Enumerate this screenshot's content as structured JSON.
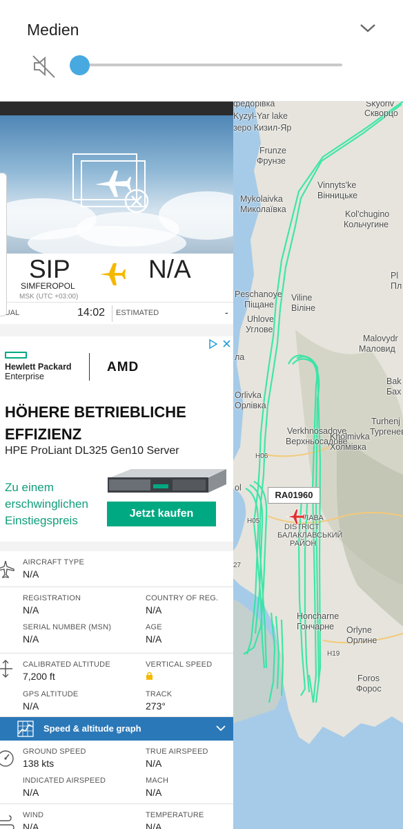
{
  "media": {
    "title": "Medien",
    "volume_level": 0.0,
    "mute_icon": "speaker-muted-icon",
    "collapse_icon": "chevron-down-icon"
  },
  "map": {
    "track_color": "#2de6a3",
    "labels": [
      {
        "text": "федорівка"
      },
      {
        "text": "Kyzyl-Yar lake"
      },
      {
        "text": "зеро Кизил-Яр"
      },
      {
        "text": "Skyoriv"
      },
      {
        "text": "Скворцо"
      },
      {
        "text": "Frunze"
      },
      {
        "text": "Фрунзе"
      },
      {
        "text": "Vinnyts'ke"
      },
      {
        "text": "Вінницьке"
      },
      {
        "text": "Mykolaivka"
      },
      {
        "text": "Миколаївка"
      },
      {
        "text": "Kol'chugino"
      },
      {
        "text": "Кольчугине"
      },
      {
        "text": "Pl"
      },
      {
        "text": "Пл"
      },
      {
        "text": "Peschanoye"
      },
      {
        "text": "Піщане"
      },
      {
        "text": "Viline"
      },
      {
        "text": "Віліне"
      },
      {
        "text": "Uhlove"
      },
      {
        "text": "Углове"
      },
      {
        "text": "Malovydr"
      },
      {
        "text": "Маловид"
      },
      {
        "text": "Bak"
      },
      {
        "text": "Бах"
      },
      {
        "text": "Orlivka"
      },
      {
        "text": "Орлівка"
      },
      {
        "text": "Turhenj"
      },
      {
        "text": "Тургенев"
      },
      {
        "text": "Verkhnosadove"
      },
      {
        "text": "Верхньосадове"
      },
      {
        "text": "Kholmivka"
      },
      {
        "text": "Холмівка"
      },
      {
        "text": "H06"
      },
      {
        "text": "H05"
      },
      {
        "text": "ЛАВА"
      },
      {
        "text": "DISTRICT"
      },
      {
        "text": "БАЛАКЛАВСЬКИЙ"
      },
      {
        "text": "РАЙОН"
      },
      {
        "text": "Honcharne"
      },
      {
        "text": "Гончарне"
      },
      {
        "text": "Orlyne"
      },
      {
        "text": "Орлине"
      },
      {
        "text": "H19"
      },
      {
        "text": "Foros"
      },
      {
        "text": "Форос"
      },
      {
        "text": "ol"
      },
      {
        "text": "ла"
      },
      {
        "text": "27"
      }
    ],
    "callsign": "RA01960"
  },
  "flight": {
    "photo_placeholder_icon": "no-photo-icon",
    "origin_code": "SIP",
    "origin_city": "SIMFEROPOL",
    "origin_tz": "MSK (UTC +03:00)",
    "destination_code": "N/A",
    "actual_label": "TUAL",
    "actual_time": "14:02",
    "estimated_label": "ESTIMATED",
    "estimated_time": "-"
  },
  "ad": {
    "brand_line1": "Hewlett Packard",
    "brand_line2": "Enterprise",
    "partner": "AMD",
    "headline": "HÖHERE BETRIEBLICHE EFFIZIENZ",
    "subline": "HPE ProLiant DL325 Gen10 Server",
    "promo": "Zu einem erschwinglichen Einstiegspreis",
    "cta": "Jetzt kaufen",
    "accent": "#01a982"
  },
  "details": {
    "aircraft_type_label": "AIRCRAFT TYPE",
    "aircraft_type": "N/A",
    "registration_label": "REGISTRATION",
    "registration": "N/A",
    "country_label": "COUNTRY OF REG.",
    "country": "N/A",
    "msn_label": "SERIAL NUMBER (MSN)",
    "msn": "N/A",
    "age_label": "AGE",
    "age": "N/A",
    "cal_alt_label": "CALIBRATED ALTITUDE",
    "cal_alt": "7,200 ft",
    "vspeed_label": "VERTICAL SPEED",
    "gps_alt_label": "GPS ALTITUDE",
    "gps_alt": "N/A",
    "track_label": "TRACK",
    "track": "273°",
    "graph_label": "Speed & altitude graph",
    "ground_speed_label": "GROUND SPEED",
    "ground_speed": "138 kts",
    "tas_label": "TRUE AIRSPEED",
    "tas": "N/A",
    "ias_label": "INDICATED AIRSPEED",
    "ias": "N/A",
    "mach_label": "MACH",
    "mach": "N/A",
    "wind_label": "WIND",
    "wind": "N/A",
    "temp_label": "TEMPERATURE",
    "temp": "N/A"
  }
}
